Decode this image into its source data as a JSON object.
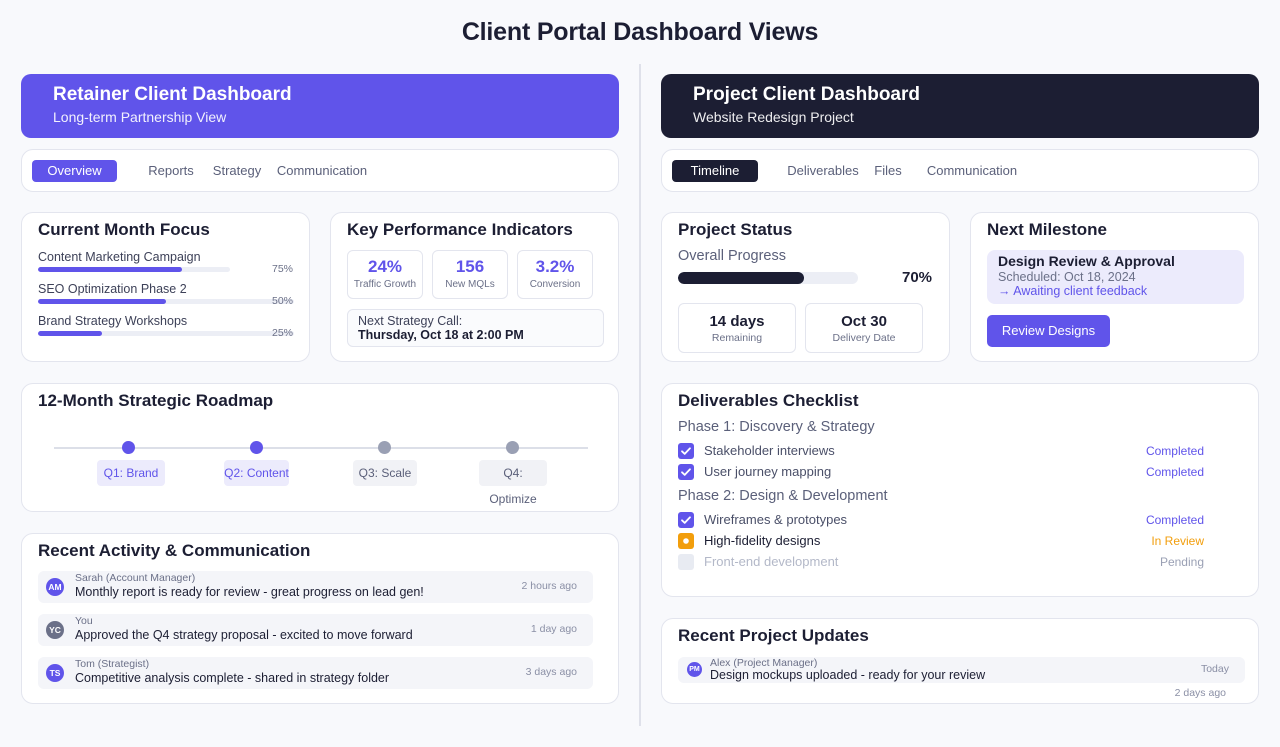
{
  "page": {
    "title": "Client Portal Dashboard Views"
  },
  "colors": {
    "accent": "#6054ea",
    "dark": "#1c1e33",
    "review": "#f29e0c",
    "pending": "#b3b8c8",
    "muted_dot": "#9aa0b4"
  },
  "retainer": {
    "banner": {
      "title": "Retainer Client Dashboard",
      "subtitle": "Long-term Partnership View"
    },
    "tabs": [
      "Overview",
      "Reports",
      "Strategy",
      "Communication"
    ],
    "active_tab": "Overview",
    "focus": {
      "title": "Current Month Focus",
      "items": [
        {
          "label": "Content Marketing Campaign",
          "percent": 75,
          "percent_label": "75%"
        },
        {
          "label": "SEO Optimization Phase 2",
          "percent": 50,
          "percent_label": "50%"
        },
        {
          "label": "Brand Strategy Workshops",
          "percent": 25,
          "percent_label": "25%"
        }
      ]
    },
    "kpis": {
      "title": "Key Performance Indicators",
      "items": [
        {
          "value": "24%",
          "label": "Traffic Growth"
        },
        {
          "value": "156",
          "label": "New MQLs"
        },
        {
          "value": "3.2%",
          "label": "Conversion"
        }
      ],
      "next_call_label": "Next Strategy Call:",
      "next_call_value": "Thursday, Oct 18 at 2:00 PM"
    },
    "roadmap": {
      "title": "12-Month Strategic Roadmap",
      "milestones": [
        {
          "label": "Q1: Brand",
          "status": "active"
        },
        {
          "label": "Q2: Content",
          "status": "active"
        },
        {
          "label": "Q3: Scale",
          "status": "upcoming"
        },
        {
          "label": "Q4: Optimize",
          "status": "upcoming"
        }
      ]
    },
    "activity": {
      "title": "Recent Activity & Communication",
      "items": [
        {
          "initials": "AM",
          "author": "Sarah (Account Manager)",
          "message": "Monthly report is ready for review - great progress on lead gen!",
          "time": "2 hours ago",
          "avatar_color": "#6054ea"
        },
        {
          "initials": "YC",
          "author": "You",
          "message": "Approved the Q4 strategy proposal - excited to move forward",
          "time": "1 day ago",
          "avatar_color": "#6b7088"
        },
        {
          "initials": "TS",
          "author": "Tom (Strategist)",
          "message": "Competitive analysis complete - shared in strategy folder",
          "time": "3 days ago",
          "avatar_color": "#6054ea"
        }
      ]
    }
  },
  "project": {
    "banner": {
      "title": "Project Client Dashboard",
      "subtitle": "Website Redesign Project"
    },
    "tabs": [
      "Timeline",
      "Deliverables",
      "Files",
      "Communication"
    ],
    "active_tab": "Timeline",
    "status": {
      "title": "Project Status",
      "progress_label": "Overall Progress",
      "progress_percent": 70,
      "progress_text": "70%",
      "stats": [
        {
          "value": "14 days",
          "label": "Remaining"
        },
        {
          "value": "Oct 30",
          "label": "Delivery Date"
        }
      ]
    },
    "milestone": {
      "title": "Next Milestone",
      "name": "Design Review & Approval",
      "scheduled": "Scheduled: Oct 18, 2024",
      "state": "→ Awaiting client feedback",
      "button": "Review Designs"
    },
    "checklist": {
      "title": "Deliverables Checklist",
      "phases": [
        {
          "name": "Phase 1: Discovery & Strategy",
          "items": [
            {
              "label": "Stakeholder interviews",
              "status": "Completed",
              "state": "done"
            },
            {
              "label": "User journey mapping",
              "status": "Completed",
              "state": "done"
            }
          ]
        },
        {
          "name": "Phase 2: Design & Development",
          "items": [
            {
              "label": "Wireframes & prototypes",
              "status": "Completed",
              "state": "done"
            },
            {
              "label": "High-fidelity designs",
              "status": "In Review",
              "state": "review"
            },
            {
              "label": "Front-end development",
              "status": "Pending",
              "state": "pending"
            }
          ]
        }
      ]
    },
    "updates": {
      "title": "Recent Project Updates",
      "items": [
        {
          "initials": "PM",
          "author": "Alex (Project Manager)",
          "message": "Design mockups uploaded - ready for your review",
          "time": "Today"
        }
      ],
      "extra_time": "2 days ago"
    }
  }
}
